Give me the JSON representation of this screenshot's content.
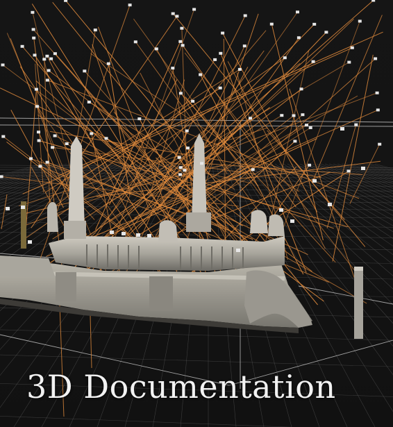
{
  "caption": "3D Documentation",
  "colors": {
    "background": "#141414",
    "grid": "#5e5e5e",
    "camera_rays": "#e08a3c",
    "camera_markers": "#e6e6e6",
    "model_stone": "#b8b5ad",
    "caption_text": "#f2f2f2"
  },
  "icons": [
    "camera-frustum-icon"
  ]
}
